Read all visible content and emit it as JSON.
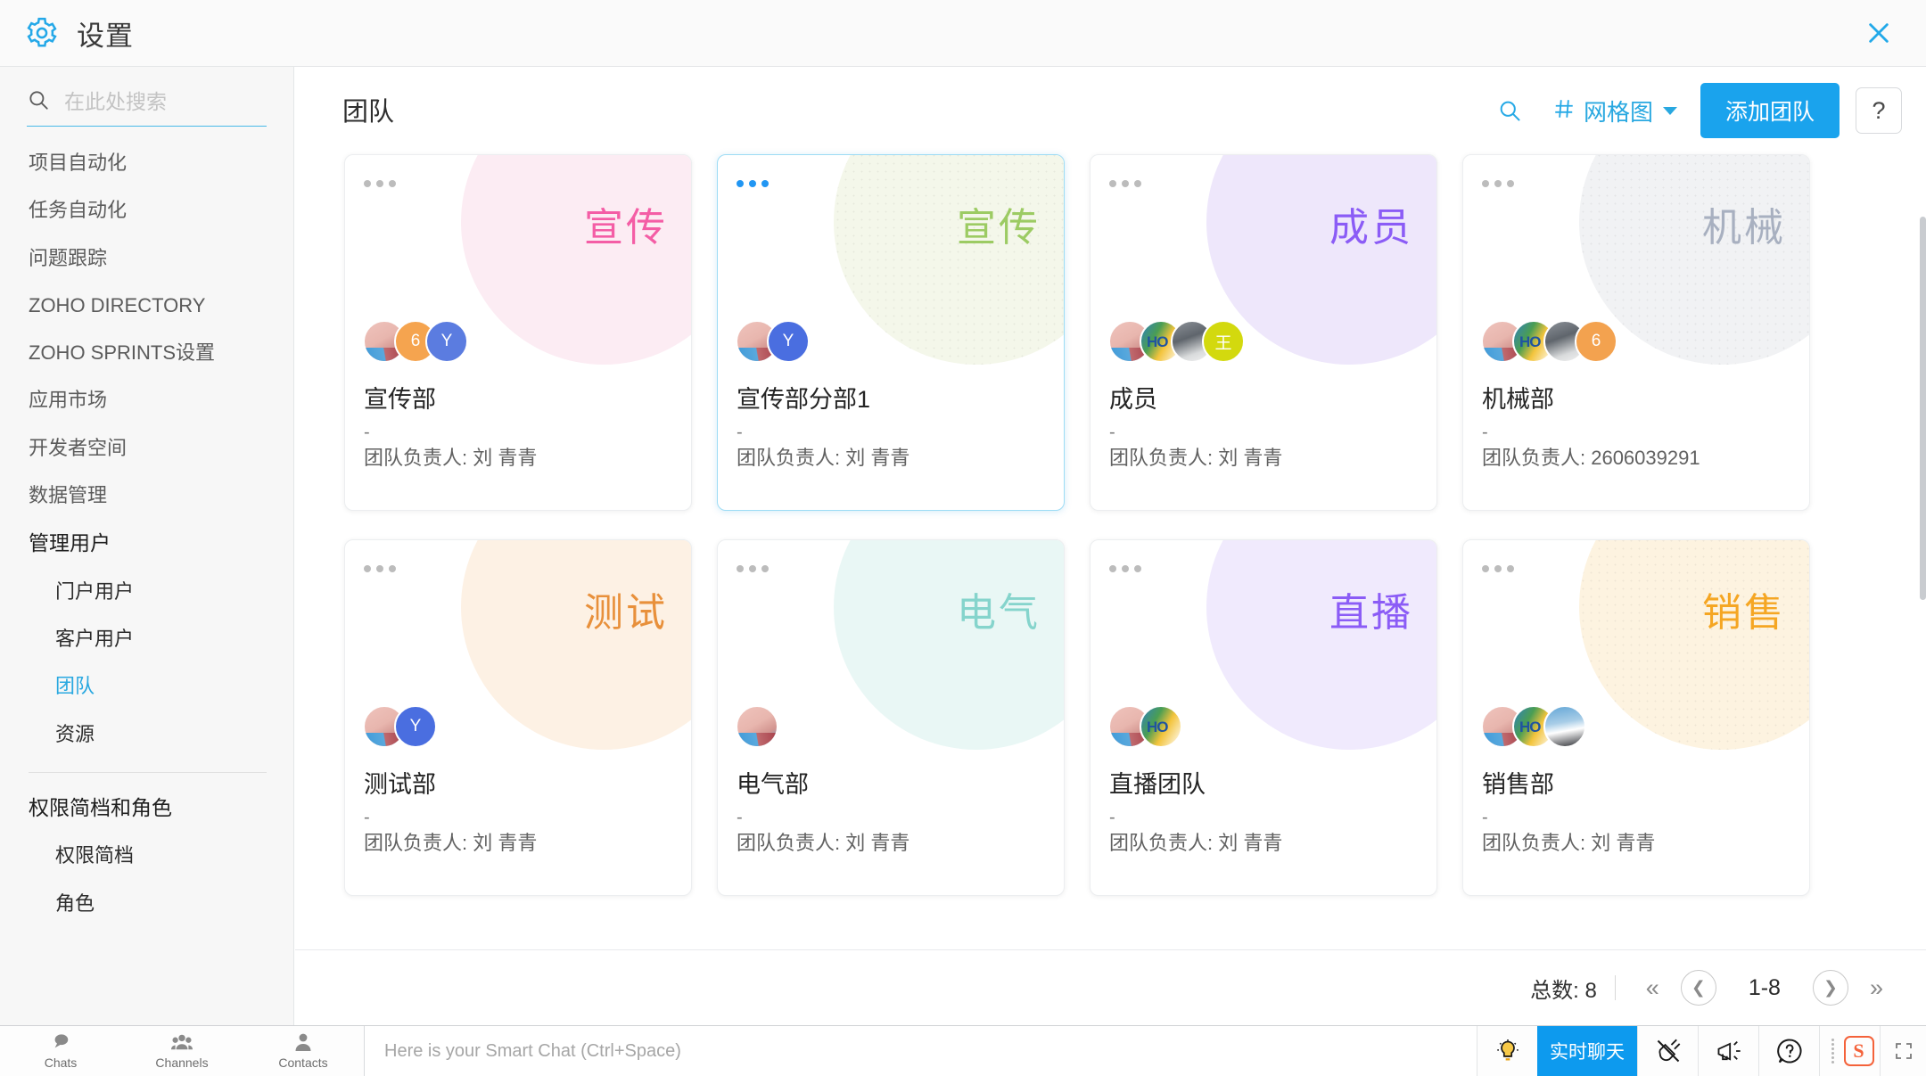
{
  "window": {
    "title": "设置",
    "gear_icon": "gear-icon",
    "close_icon": "close-icon"
  },
  "sidebar": {
    "search": {
      "placeholder": "在此处搜索",
      "value": "",
      "icon": "search-icon"
    },
    "items": [
      {
        "label": "项目自动化",
        "type": "item",
        "active": false
      },
      {
        "label": "任务自动化",
        "type": "item",
        "active": false
      },
      {
        "label": "问题跟踪",
        "type": "item",
        "active": false
      },
      {
        "label": "ZOHO DIRECTORY",
        "type": "item",
        "active": false
      },
      {
        "label": "ZOHO SPRINTS设置",
        "type": "item",
        "active": false
      },
      {
        "label": "应用市场",
        "type": "item",
        "active": false
      },
      {
        "label": "开发者空间",
        "type": "item",
        "active": false
      },
      {
        "label": "数据管理",
        "type": "item",
        "active": false
      },
      {
        "label": "管理用户",
        "type": "group",
        "active": false
      },
      {
        "label": "门户用户",
        "type": "sub",
        "active": false
      },
      {
        "label": "客户用户",
        "type": "sub",
        "active": false
      },
      {
        "label": "团队",
        "type": "sub",
        "active": true
      },
      {
        "label": "资源",
        "type": "sub",
        "active": false
      },
      {
        "label": "权限简档和角色",
        "type": "group",
        "active": false,
        "separator_before": true
      },
      {
        "label": "权限简档",
        "type": "sub",
        "active": false
      },
      {
        "label": "角色",
        "type": "sub",
        "active": false
      }
    ]
  },
  "main": {
    "page_title": "团队",
    "toolbar": {
      "search_icon": "search-icon",
      "view_icon": "grid-view-icon",
      "view_label": "网格图",
      "caret_icon": "chevron-down-icon",
      "add_button": "添加团队",
      "help_button": "?"
    },
    "cards": [
      {
        "badge": "宣传",
        "title": "宣传部",
        "dash": "-",
        "owner": "团队负责人: 刘 青青",
        "blob_color": "#fcecf3",
        "badge_color": "#f45da5",
        "selected": false,
        "dots_active": false,
        "dotted": false,
        "avatars": [
          {
            "kind": "photo1",
            "initials": ""
          },
          {
            "kind": "initial",
            "initials": "6",
            "color": "#f5a44f"
          },
          {
            "kind": "initial",
            "initials": "Y",
            "color": "#5b7ce0"
          }
        ]
      },
      {
        "badge": "宣传",
        "title": "宣传部分部1",
        "dash": "-",
        "owner": "团队负责人: 刘 青青",
        "blob_color": "#f4f7ea",
        "badge_color": "#9ccb63",
        "selected": true,
        "dots_active": true,
        "dotted": true,
        "avatars": [
          {
            "kind": "photo1",
            "initials": ""
          },
          {
            "kind": "initial",
            "initials": "Y",
            "color": "#4a6ee0"
          }
        ]
      },
      {
        "badge": "成员",
        "title": "成员",
        "dash": "-",
        "owner": "团队负责人: 刘 青青",
        "blob_color": "#eee7fb",
        "badge_color": "#8b5cf6",
        "selected": false,
        "dots_active": false,
        "dotted": false,
        "avatars": [
          {
            "kind": "photo1",
            "initials": ""
          },
          {
            "kind": "photo2",
            "initials": ""
          },
          {
            "kind": "photo3",
            "initials": ""
          },
          {
            "kind": "initial",
            "initials": "王",
            "color": "#d3d90e"
          }
        ]
      },
      {
        "badge": "机械",
        "title": "机械部",
        "dash": "-",
        "owner": "团队负责人: 2606039291",
        "blob_color": "#f1f2f4",
        "badge_color": "#a8b0c0",
        "selected": false,
        "dots_active": false,
        "dotted": true,
        "avatars": [
          {
            "kind": "photo1",
            "initials": ""
          },
          {
            "kind": "photo2",
            "initials": ""
          },
          {
            "kind": "photo3",
            "initials": ""
          },
          {
            "kind": "initial",
            "initials": "6",
            "color": "#f3a24f"
          }
        ]
      },
      {
        "badge": "测试",
        "title": "测试部",
        "dash": "-",
        "owner": "团队负责人: 刘 青青",
        "blob_color": "#fdf1e4",
        "badge_color": "#e8903b",
        "selected": false,
        "dots_active": false,
        "dotted": false,
        "avatars": [
          {
            "kind": "photo1",
            "initials": ""
          },
          {
            "kind": "initial",
            "initials": "Y",
            "color": "#4a6ee0"
          }
        ]
      },
      {
        "badge": "电气",
        "title": "电气部",
        "dash": "-",
        "owner": "团队负责人: 刘 青青",
        "blob_color": "#e9f7f5",
        "badge_color": "#85d4cc",
        "selected": false,
        "dots_active": false,
        "dotted": false,
        "avatars": [
          {
            "kind": "photo1",
            "initials": ""
          }
        ]
      },
      {
        "badge": "直播",
        "title": "直播团队",
        "dash": "-",
        "owner": "团队负责人: 刘 青青",
        "blob_color": "#f0eafd",
        "badge_color": "#8b5cf6",
        "selected": false,
        "dots_active": false,
        "dotted": false,
        "avatars": [
          {
            "kind": "photo1",
            "initials": ""
          },
          {
            "kind": "photo2",
            "initials": ""
          }
        ]
      },
      {
        "badge": "销售",
        "title": "销售部",
        "dash": "-",
        "owner": "团队负责人: 刘 青青",
        "blob_color": "#fdf3e0",
        "badge_color": "#f5a623",
        "selected": false,
        "dots_active": false,
        "dotted": true,
        "avatars": [
          {
            "kind": "photo1",
            "initials": ""
          },
          {
            "kind": "photo2",
            "initials": ""
          },
          {
            "kind": "photo4",
            "initials": ""
          }
        ]
      }
    ],
    "pagination": {
      "total_label": "总数: 8",
      "first_icon": "double-chevron-left-icon",
      "prev_icon": "chevron-left-icon",
      "range": "1-8",
      "next_icon": "chevron-right-icon",
      "last_icon": "double-chevron-right-icon"
    }
  },
  "taskbar": {
    "items": [
      {
        "label": "Chats",
        "icon": "chat-bubble-icon"
      },
      {
        "label": "Channels",
        "icon": "channels-icon"
      },
      {
        "label": "Contacts",
        "icon": "contact-icon"
      }
    ],
    "chat_placeholder": "Here is your Smart Chat (Ctrl+Space)",
    "chat_value": "",
    "right": {
      "bulb_icon": "lightbulb-icon",
      "live_chat_label": "实时聊天",
      "plug_off_icon": "plug-disconnected-icon",
      "megaphone_icon": "megaphone-icon",
      "help_icon": "question-circle-icon",
      "sogou_icon": "sogou-ime-icon",
      "resize_icon": "resize-icon"
    }
  },
  "colors": {
    "accent": "#1aa3ed",
    "sidebar_bg": "#f7f7f7",
    "active_nav": "#29a8e0"
  }
}
